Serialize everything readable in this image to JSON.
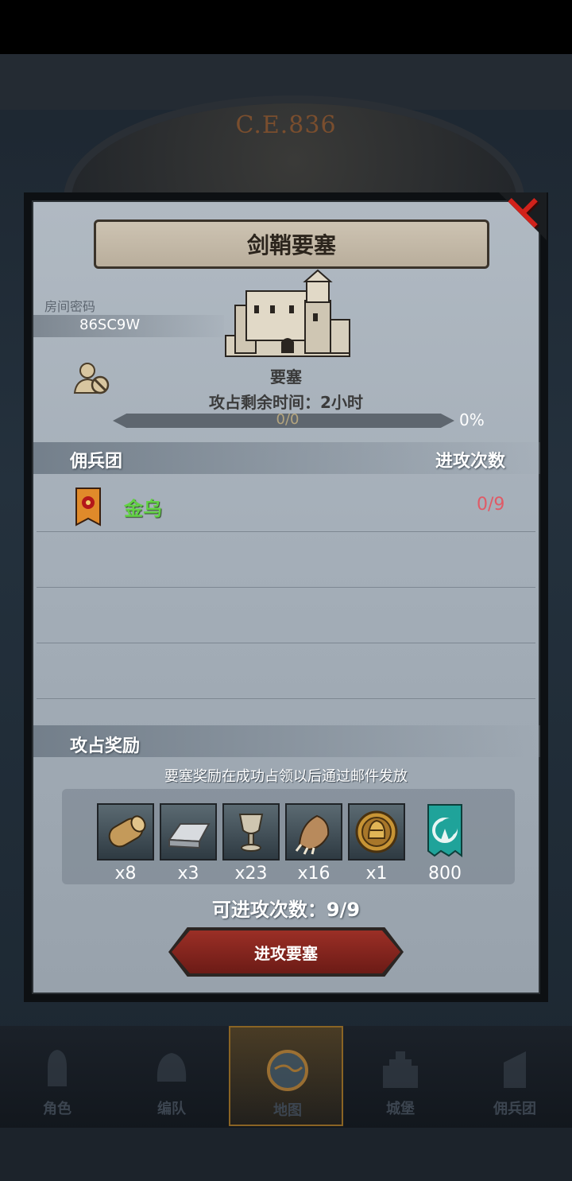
{
  "header": {
    "year": "C.E.836"
  },
  "dialog": {
    "title": "剑鞘要塞",
    "room_label": "房间密码",
    "room_code": "86SC9W",
    "building_label": "要塞",
    "time_remaining": "攻占剩余时间：2小时",
    "progress": {
      "text": "0/0",
      "percent_text": "0%",
      "fraction": 0
    },
    "mercenary_section": {
      "left_title": "佣兵团",
      "right_title": "进攻次数"
    },
    "mercenaries": [
      {
        "name": "金乌",
        "attacks": "0/9"
      }
    ],
    "reward_section": {
      "title": "攻占奖励",
      "note": "要塞奖励在成功占领以后通过邮件发放",
      "items": [
        {
          "icon": "wood-log-icon",
          "qty": "x8"
        },
        {
          "icon": "iron-ingot-icon",
          "qty": "x3"
        },
        {
          "icon": "goblet-icon",
          "qty": "x23"
        },
        {
          "icon": "beast-claw-icon",
          "qty": "x16"
        },
        {
          "icon": "knight-medal-icon",
          "qty": "x1"
        },
        {
          "icon": "guild-banner-icon",
          "qty": "800"
        }
      ]
    },
    "attempts": "可进攻次数：9/9",
    "attack_button": "进攻要塞"
  },
  "nav": {
    "items": [
      {
        "label": "角色",
        "icon": "knight-icon"
      },
      {
        "label": "编队",
        "icon": "helmet-icon"
      },
      {
        "label": "地图",
        "icon": "map-icon"
      },
      {
        "label": "城堡",
        "icon": "castle-icon"
      },
      {
        "label": "佣兵团",
        "icon": "mercenary-icon"
      }
    ],
    "active_index": 2
  },
  "colors": {
    "close": "#d1221b",
    "merc_name": "#62d244",
    "attack_count": "#e05a66",
    "attack_button": "#9b2f26"
  }
}
